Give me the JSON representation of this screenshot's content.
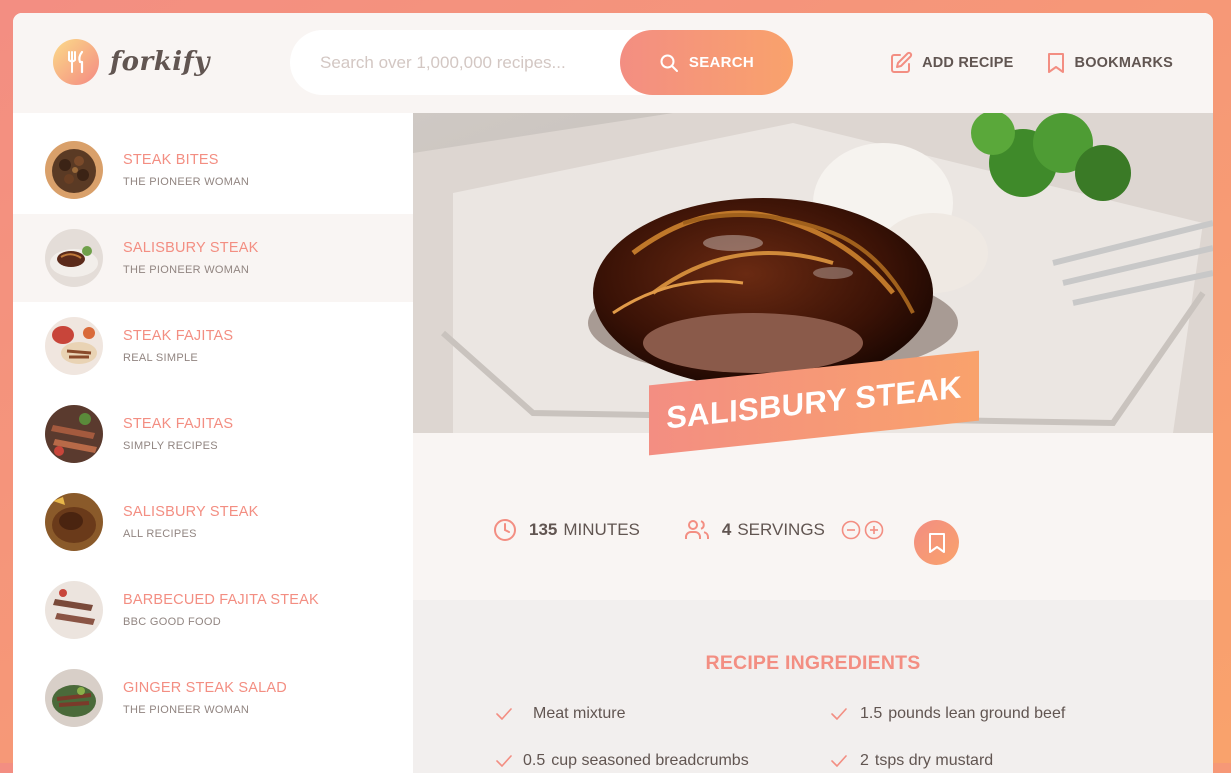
{
  "brand": {
    "name": "forkify"
  },
  "search": {
    "placeholder": "Search over 1,000,000 recipes...",
    "button_label": "SEARCH"
  },
  "nav": {
    "add_recipe": "ADD RECIPE",
    "bookmarks": "BOOKMARKS"
  },
  "results": [
    {
      "title": "STEAK BITES",
      "publisher": "THE PIONEER WOMAN"
    },
    {
      "title": "SALISBURY STEAK",
      "publisher": "THE PIONEER WOMAN"
    },
    {
      "title": "STEAK FAJITAS",
      "publisher": "REAL SIMPLE"
    },
    {
      "title": "STEAK FAJITAS",
      "publisher": "SIMPLY RECIPES"
    },
    {
      "title": "SALISBURY STEAK",
      "publisher": "ALL RECIPES"
    },
    {
      "title": "BARBECUED FAJITA STEAK",
      "publisher": "BBC GOOD FOOD"
    },
    {
      "title": "GINGER STEAK SALAD",
      "publisher": "THE PIONEER WOMAN"
    }
  ],
  "recipe": {
    "title": "SALISBURY STEAK",
    "cooking_time": "135",
    "cooking_time_label": "MINUTES",
    "servings": "4",
    "servings_label": "SERVINGS",
    "ingredients_heading": "RECIPE INGREDIENTS",
    "ingredients": [
      {
        "quantity": "",
        "description": "Meat mixture"
      },
      {
        "quantity": "1.5",
        "description": "pounds lean ground beef"
      },
      {
        "quantity": "0.5",
        "description": "cup seasoned breadcrumbs"
      },
      {
        "quantity": "2",
        "description": "tsps dry mustard"
      }
    ]
  },
  "colors": {
    "primary": "#f38e82",
    "gradient_end": "#f9a26c",
    "text": "#615551",
    "light_bg": "#f9f5f3"
  },
  "icons": {
    "logo": "fork-knife-icon",
    "search": "search-icon",
    "add_recipe": "edit-icon",
    "bookmarks": "bookmark-icon",
    "clock": "clock-icon",
    "users": "users-icon",
    "minus": "minus-circle-icon",
    "plus": "plus-circle-icon",
    "bookmark_btn": "bookmark-icon",
    "check": "check-icon"
  }
}
